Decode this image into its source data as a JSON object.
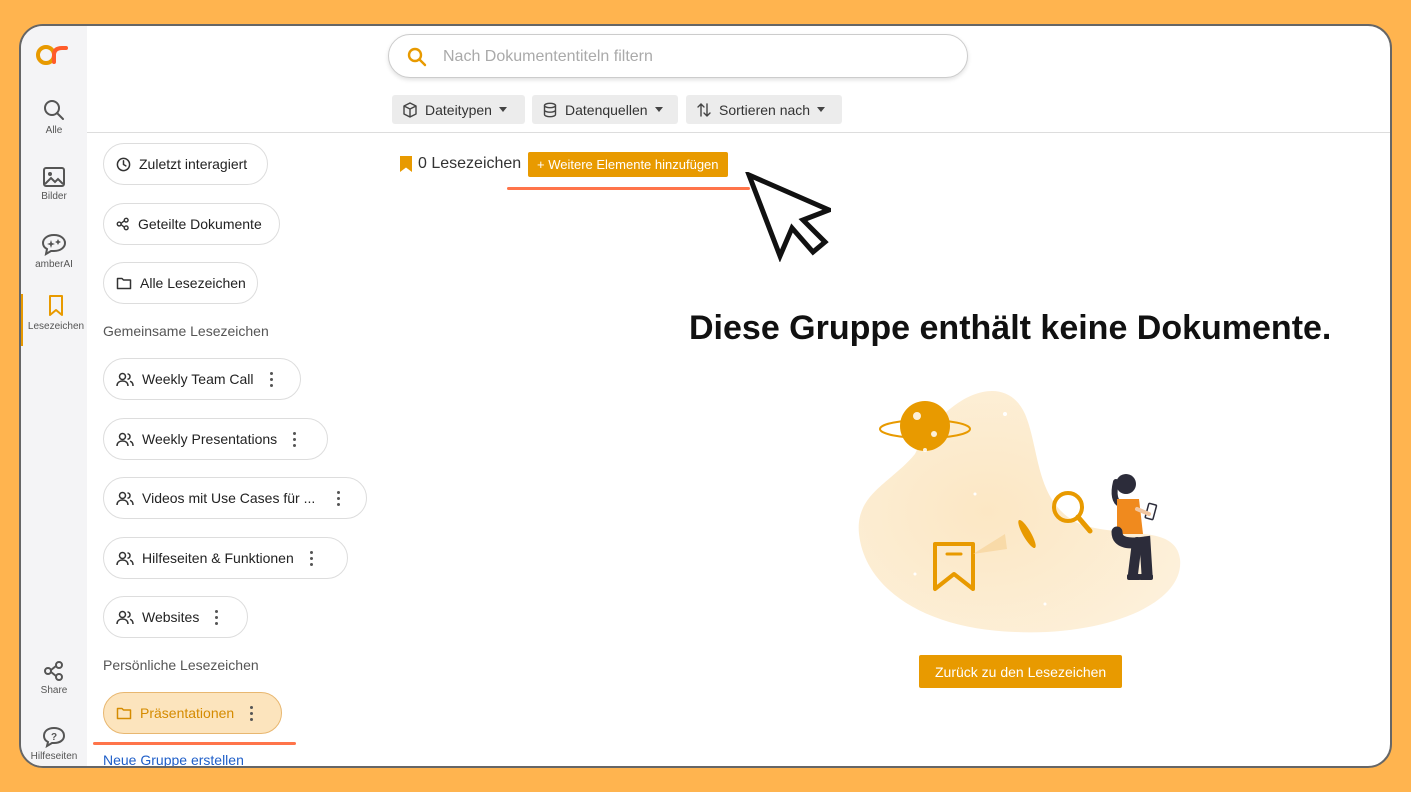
{
  "search": {
    "placeholder": "Nach Dokumententiteln filtern"
  },
  "filters": [
    {
      "label": "Dateitypen",
      "icon": "cube-icon"
    },
    {
      "label": "Datenquellen",
      "icon": "database-icon"
    },
    {
      "label": "Sortieren nach",
      "icon": "sort-icon"
    }
  ],
  "rail": {
    "items": [
      {
        "label": "Alle",
        "icon": "search-icon"
      },
      {
        "label": "Bilder",
        "icon": "image-icon"
      },
      {
        "label": "amberAI",
        "icon": "ai-chat-icon"
      },
      {
        "label": "Lesezeichen",
        "icon": "bookmark-icon",
        "active": true
      },
      {
        "label": "Share",
        "icon": "share-icon"
      },
      {
        "label": "Hilfeseiten",
        "icon": "help-icon"
      }
    ]
  },
  "sidebar": {
    "top_items": [
      {
        "label": "Zuletzt interagiert",
        "icon": "clock-icon"
      },
      {
        "label": "Geteilte Dokumente",
        "icon": "share-icon"
      },
      {
        "label": "Alle Lesezeichen",
        "icon": "folder-icon"
      }
    ],
    "shared_heading": "Gemeinsame Lesezeichen",
    "shared_items": [
      {
        "label": "Weekly Team Call"
      },
      {
        "label": "Weekly Presentations"
      },
      {
        "label": "Videos mit Use Cases für ..."
      },
      {
        "label": "Hilfeseiten & Funktionen"
      },
      {
        "label": "Websites"
      }
    ],
    "personal_heading": "Persönliche Lesezeichen",
    "personal_items": [
      {
        "label": "Präsentationen",
        "active": true
      }
    ],
    "create_group_link": "Neue Gruppe erstellen"
  },
  "main": {
    "bookmark_count": "0 Lesezeichen",
    "add_button": "+ Weitere Elemente hinzufügen",
    "empty_title": "Diese Gruppe enthält keine Dokumente.",
    "back_button": "Zurück zu den Lesezeichen"
  },
  "colors": {
    "accent": "#E89A00",
    "background": "#FFB44F",
    "active_pill": "#FCE4BD",
    "link": "#1F5FC9",
    "highlight": "#FF5C2A"
  }
}
